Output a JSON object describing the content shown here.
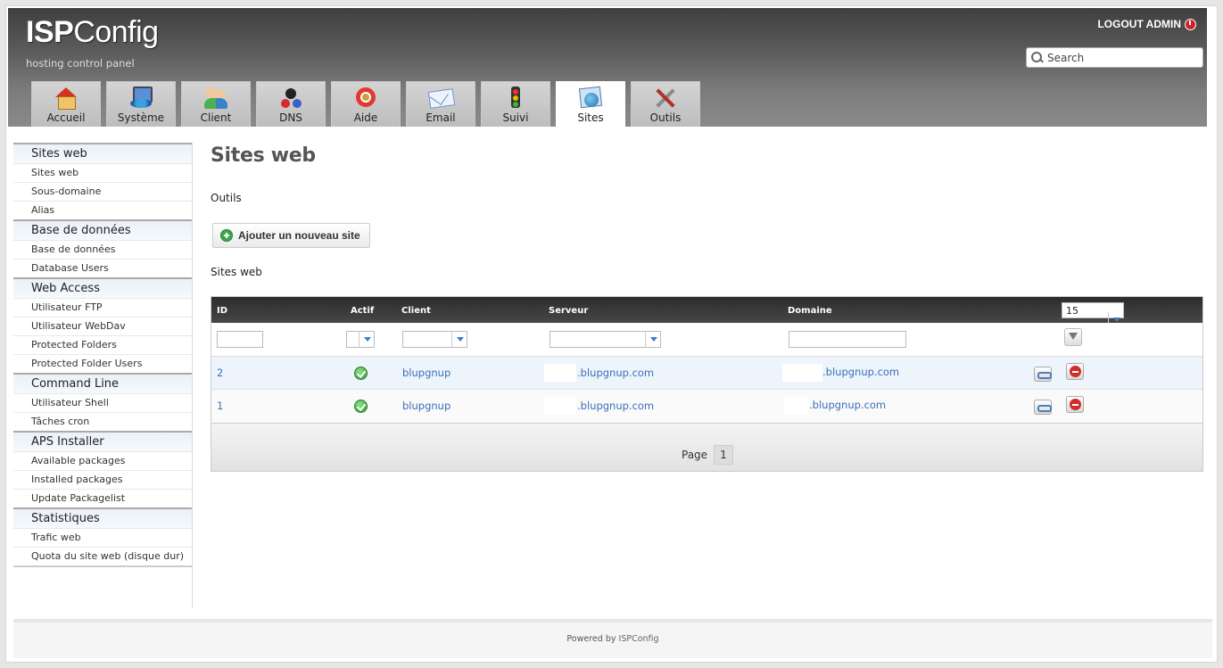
{
  "header": {
    "logo_bold": "ISP",
    "logo_rest": "Config",
    "tagline": "hosting control panel",
    "logout": "LOGOUT ADMIN",
    "search_placeholder": "Search"
  },
  "tabs": [
    {
      "label": "Accueil",
      "icon": "house-icon"
    },
    {
      "label": "Système",
      "icon": "system-icon"
    },
    {
      "label": "Client",
      "icon": "client-icon"
    },
    {
      "label": "DNS",
      "icon": "dns-icon"
    },
    {
      "label": "Aide",
      "icon": "help-icon"
    },
    {
      "label": "Email",
      "icon": "email-icon"
    },
    {
      "label": "Suivi",
      "icon": "traffic-light-icon"
    },
    {
      "label": "Sites",
      "icon": "sites-icon",
      "active": true
    },
    {
      "label": "Outils",
      "icon": "tools-icon"
    }
  ],
  "sidebar": {
    "sections": [
      {
        "title": "Sites web",
        "items": [
          "Sites web",
          "Sous-domaine",
          "Alias"
        ]
      },
      {
        "title": "Base de données",
        "items": [
          "Base de données",
          "Database Users"
        ]
      },
      {
        "title": "Web Access",
        "items": [
          "Utilisateur FTP",
          "Utilisateur WebDav",
          "Protected Folders",
          "Protected Folder Users"
        ]
      },
      {
        "title": "Command Line",
        "items": [
          "Utilisateur Shell",
          "Tâches cron"
        ]
      },
      {
        "title": "APS Installer",
        "items": [
          "Available packages",
          "Installed packages",
          "Update Packagelist"
        ]
      },
      {
        "title": "Statistiques",
        "items": [
          "Trafic web",
          "Quota du site web (disque dur)"
        ]
      }
    ]
  },
  "main": {
    "title": "Sites web",
    "tools_label": "Outils",
    "add_button": "Ajouter un nouveau site",
    "list_label": "Sites web",
    "columns": {
      "id": "ID",
      "active": "Actif",
      "client": "Client",
      "server": "Serveur",
      "domain": "Domaine"
    },
    "page_size": "15",
    "rows": [
      {
        "id": "2",
        "active": true,
        "client": "blupgnup",
        "server": ".blupgnup.com",
        "domain": ".blupgnup.com"
      },
      {
        "id": "1",
        "active": true,
        "client": "blupgnup",
        "server": ".blupgnup.com",
        "domain": ".blupgnup.com"
      }
    ],
    "page_label": "Page",
    "page_number": "1"
  },
  "footer": {
    "powered_by": "Powered by",
    "brand": "ISPConfig"
  },
  "colors": {
    "link": "#3871b8",
    "header_dark": "#3f3f3f",
    "grid_header": "#2c2c2c",
    "sidebar_section_bg": "#e9f1f8",
    "active_check": "#2f9a33",
    "delete_red": "#d32b2b"
  }
}
